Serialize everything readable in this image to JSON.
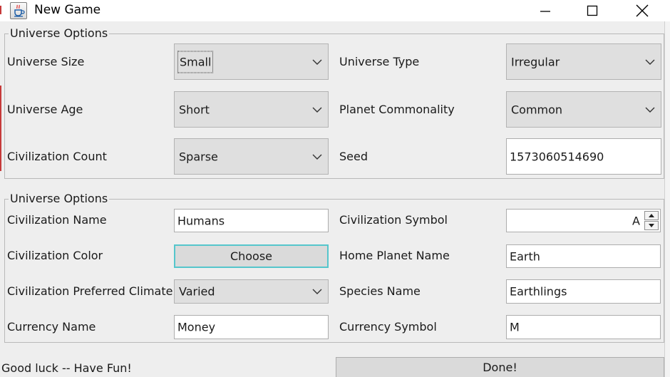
{
  "window": {
    "title": "New Game",
    "icon": "java-cup-icon",
    "controls": [
      "minimize-icon",
      "maximize-icon",
      "close-icon"
    ]
  },
  "universe_panel": {
    "legend": "Universe Options",
    "size": {
      "label": "Universe Size",
      "value": "Small"
    },
    "type": {
      "label": "Universe Type",
      "value": "Irregular"
    },
    "age": {
      "label": "Universe Age",
      "value": "Short"
    },
    "planet": {
      "label": "Planet Commonality",
      "value": "Common"
    },
    "civcount": {
      "label": "Civilization Count",
      "value": "Sparse"
    },
    "seed": {
      "label": "Seed",
      "value": "1573060514690"
    }
  },
  "civ_panel": {
    "legend": "Universe Options",
    "name": {
      "label": "Civilization Name",
      "value": "Humans"
    },
    "symbol": {
      "label": "Civilization Symbol",
      "value": "A"
    },
    "color": {
      "label": "Civilization Color",
      "button": "Choose"
    },
    "home": {
      "label": "Home Planet Name",
      "value": "Earth"
    },
    "climate": {
      "label": "Civilization Preferred Climate",
      "value": "Varied"
    },
    "species": {
      "label": "Species Name",
      "value": "Earthlings"
    },
    "currency": {
      "label": "Currency Name",
      "value": "Money"
    },
    "currency_symbol": {
      "label": "Currency Symbol",
      "value": "M"
    }
  },
  "footer": {
    "message": "Good luck -- Have Fun!",
    "done": "Done!"
  },
  "colors": {
    "focus_border": "#55c6cc",
    "window_bg": "#eeeeee"
  }
}
